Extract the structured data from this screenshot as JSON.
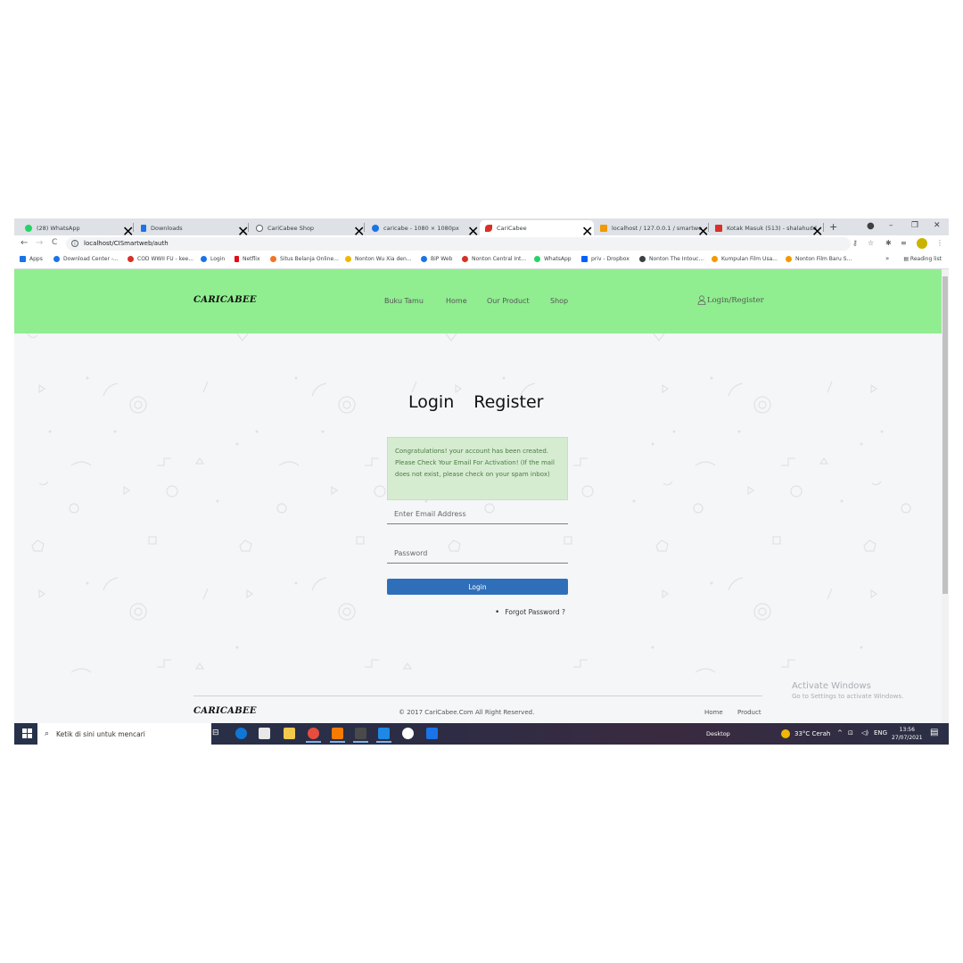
{
  "browser": {
    "tabs": [
      {
        "title": "(28) WhatsApp",
        "icon": "whatsapp-icon",
        "color": "#25d366"
      },
      {
        "title": "Downloads",
        "icon": "download-icon",
        "color": "#1a73e8"
      },
      {
        "title": "CariCabee Shop",
        "icon": "shop-icon",
        "color": "#5f6368"
      },
      {
        "title": "caricabe - 1080 × 1080px",
        "icon": "canva-icon",
        "color": "#1a73e8"
      },
      {
        "title": "CariCabee",
        "icon": "chili-icon",
        "color": "#d93025"
      },
      {
        "title": "localhost / 127.0.0.1 / smartweb",
        "icon": "phpmyadmin-icon",
        "color": "#f29900"
      },
      {
        "title": "Kotak Masuk (513) - shalahuddi...",
        "icon": "gmail-icon",
        "color": "#d93025"
      }
    ],
    "new_tab": "+",
    "url": "localhost/CISmartweb/auth",
    "window_controls": {
      "minimize": "–",
      "restore": "❐",
      "close": "✕"
    },
    "bookmarks": [
      {
        "label": "Apps",
        "color": "#1a73e8"
      },
      {
        "label": "Download Center -...",
        "color": "#1a73e8"
      },
      {
        "label": "COD WWII FU - kee...",
        "color": "#d93025"
      },
      {
        "label": "Login",
        "color": "#1a73e8"
      },
      {
        "label": "Netflix",
        "color": "#e50914"
      },
      {
        "label": "Situs Belanja Online...",
        "color": "#f57224"
      },
      {
        "label": "Nonton Wu Xia den...",
        "color": "#f2b705"
      },
      {
        "label": "BiP Web",
        "color": "#1a73e8"
      },
      {
        "label": "Nonton Central Int...",
        "color": "#d93025"
      },
      {
        "label": "WhatsApp",
        "color": "#25d366"
      },
      {
        "label": "priv - Dropbox",
        "color": "#0061fe"
      },
      {
        "label": "Nonton The Intouc...",
        "color": "#3c4043"
      },
      {
        "label": "Kumpulan Film Usa...",
        "color": "#f29900"
      },
      {
        "label": "Nonton Film Baru S...",
        "color": "#f29900"
      }
    ],
    "bookmarks_more": "»",
    "reading_list": "Reading list"
  },
  "site": {
    "logo": "CARICABEE",
    "nav": [
      "Buku Tamu",
      "Home",
      "Our Product",
      "Shop"
    ],
    "login_register": "Login/Register",
    "header_color": "#90ee90"
  },
  "auth": {
    "tab_login": "Login",
    "tab_register": "Register",
    "alert": "Congratulations! your account has been created. Please Check Your Email For Activation! (If the mail does not exist, please check on your spam inbox)",
    "email_placeholder": "Enter Email Address",
    "password_placeholder": "Password",
    "login_button": "Login",
    "forgot_password": "Forgot Password ?",
    "button_color": "#2f6fba"
  },
  "footer": {
    "logo": "CARICABEE",
    "copyright": "© 2017 CariCabee.Com All Right Reserved.",
    "links": [
      "Home",
      "Product"
    ]
  },
  "watermark": {
    "title": "Activate Windows",
    "subtitle": "Go to Settings to activate Windows."
  },
  "taskbar": {
    "search_placeholder": "Ketik di sini untuk mencari",
    "desktop": "Desktop",
    "weather": "33°C  Cerah",
    "language": "ENG",
    "time": "13:56",
    "date": "27/07/2021"
  }
}
